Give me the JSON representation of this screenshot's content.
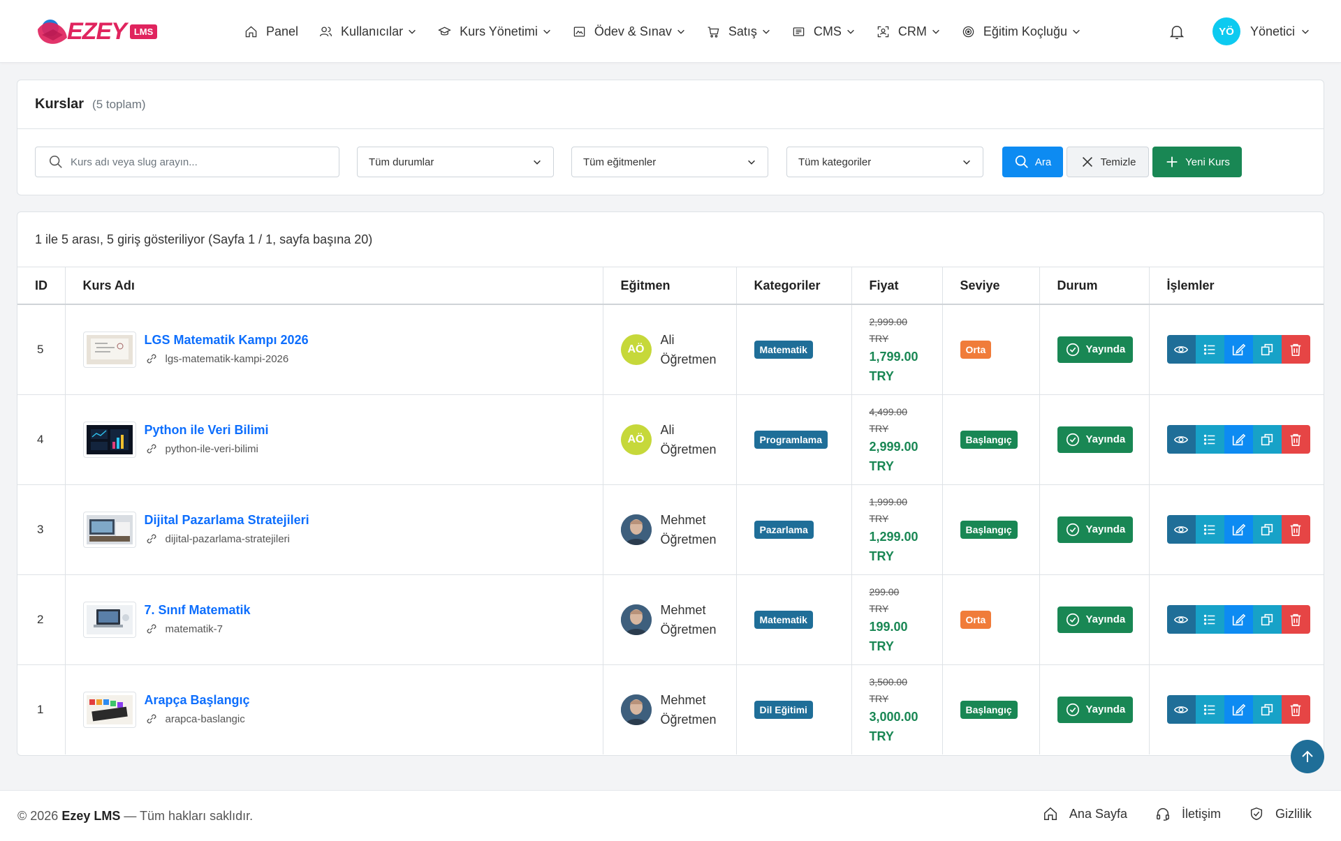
{
  "brand": {
    "name": "EZEY",
    "tag": "LMS",
    "color": "#e0245e"
  },
  "nav": [
    {
      "label": "Panel",
      "icon": "home-icon",
      "dropdown": false
    },
    {
      "label": "Kullanıcılar",
      "icon": "users-icon",
      "dropdown": true
    },
    {
      "label": "Kurs Yönetimi",
      "icon": "graduation-cap-icon",
      "dropdown": true
    },
    {
      "label": "Ödev & Sınav",
      "icon": "image-icon",
      "dropdown": true
    },
    {
      "label": "Satış",
      "icon": "cart-icon",
      "dropdown": true
    },
    {
      "label": "CMS",
      "icon": "cms-icon",
      "dropdown": true
    },
    {
      "label": "CRM",
      "icon": "crm-icon",
      "dropdown": true
    },
    {
      "label": "Eğitim Koçluğu",
      "icon": "target-icon",
      "dropdown": true
    }
  ],
  "user": {
    "initials": "YÖ",
    "name": "Yönetici"
  },
  "page": {
    "title": "Kurslar",
    "count": "(5 toplam)"
  },
  "filters": {
    "search_placeholder": "Kurs adı veya slug arayın...",
    "status": "Tüm durumlar",
    "teacher": "Tüm eğitmenler",
    "category": "Tüm kategoriler",
    "search_button": "Ara",
    "clear_button": "Temizle",
    "new_button": "Yeni Kurs"
  },
  "table": {
    "info": "1 ile 5 arası, 5 giriş gösteriliyor (Sayfa 1 / 1, sayfa başına 20)",
    "headers": [
      "ID",
      "Kurs Adı",
      "Eğitmen",
      "Kategoriler",
      "Fiyat",
      "Seviye",
      "Durum",
      "İşlemler"
    ],
    "rows": [
      {
        "id": "5",
        "name": "LGS Matematik Kampı 2026",
        "slug": "lgs-matematik-kampi-2026",
        "thumb": "whiteboard",
        "teacher": {
          "line1": "Ali",
          "line2": "Öğretmen",
          "initials": "AÖ",
          "type": "initials"
        },
        "category": "Matematik",
        "price_old": "2,999.00",
        "price_old_cur": "TRY",
        "price_new": "1,799.00",
        "price_new_cur": "TRY",
        "level": "Orta",
        "level_type": "orta",
        "status": "Yayında"
      },
      {
        "id": "4",
        "name": "Python ile Veri Bilimi",
        "slug": "python-ile-veri-bilimi",
        "thumb": "dashboard",
        "teacher": {
          "line1": "Ali",
          "line2": "Öğretmen",
          "initials": "AÖ",
          "type": "initials"
        },
        "category": "Programlama",
        "price_old": "4,499.00",
        "price_old_cur": "TRY",
        "price_new": "2,999.00",
        "price_new_cur": "TRY",
        "level": "Başlangıç",
        "level_type": "basl",
        "status": "Yayında"
      },
      {
        "id": "3",
        "name": "Dijital Pazarlama Stratejileri",
        "slug": "dijital-pazarlama-stratejileri",
        "thumb": "desk",
        "teacher": {
          "line1": "Mehmet",
          "line2": "Öğretmen",
          "initials": "",
          "type": "photo"
        },
        "category": "Pazarlama",
        "price_old": "1,999.00",
        "price_old_cur": "TRY",
        "price_new": "1,299.00",
        "price_new_cur": "TRY",
        "level": "Başlangıç",
        "level_type": "basl",
        "status": "Yayında"
      },
      {
        "id": "2",
        "name": "7. Sınıf Matematik",
        "slug": "matematik-7",
        "thumb": "laptop",
        "teacher": {
          "line1": "Mehmet",
          "line2": "Öğretmen",
          "initials": "",
          "type": "photo"
        },
        "category": "Matematik",
        "price_old": "299.00",
        "price_old_cur": "TRY",
        "price_new": "199.00",
        "price_new_cur": "TRY",
        "level": "Orta",
        "level_type": "orta",
        "status": "Yayında"
      },
      {
        "id": "1",
        "name": "Arapça Başlangıç",
        "slug": "arapca-baslangic",
        "thumb": "colors",
        "teacher": {
          "line1": "Mehmet",
          "line2": "Öğretmen",
          "initials": "",
          "type": "photo"
        },
        "category": "Dil Eğitimi",
        "price_old": "3,500.00",
        "price_old_cur": "TRY",
        "price_new": "3,000.00",
        "price_new_cur": "TRY",
        "level": "Başlangıç",
        "level_type": "basl",
        "status": "Yayında"
      }
    ]
  },
  "footer": {
    "year": "© 2026",
    "brand": "Ezey LMS",
    "rights": "— Tüm hakları saklıdır.",
    "links": [
      {
        "label": "Ana Sayfa",
        "icon": "home-icon"
      },
      {
        "label": "İletişim",
        "icon": "headset-icon"
      },
      {
        "label": "Gizlilik",
        "icon": "shield-icon"
      }
    ]
  }
}
